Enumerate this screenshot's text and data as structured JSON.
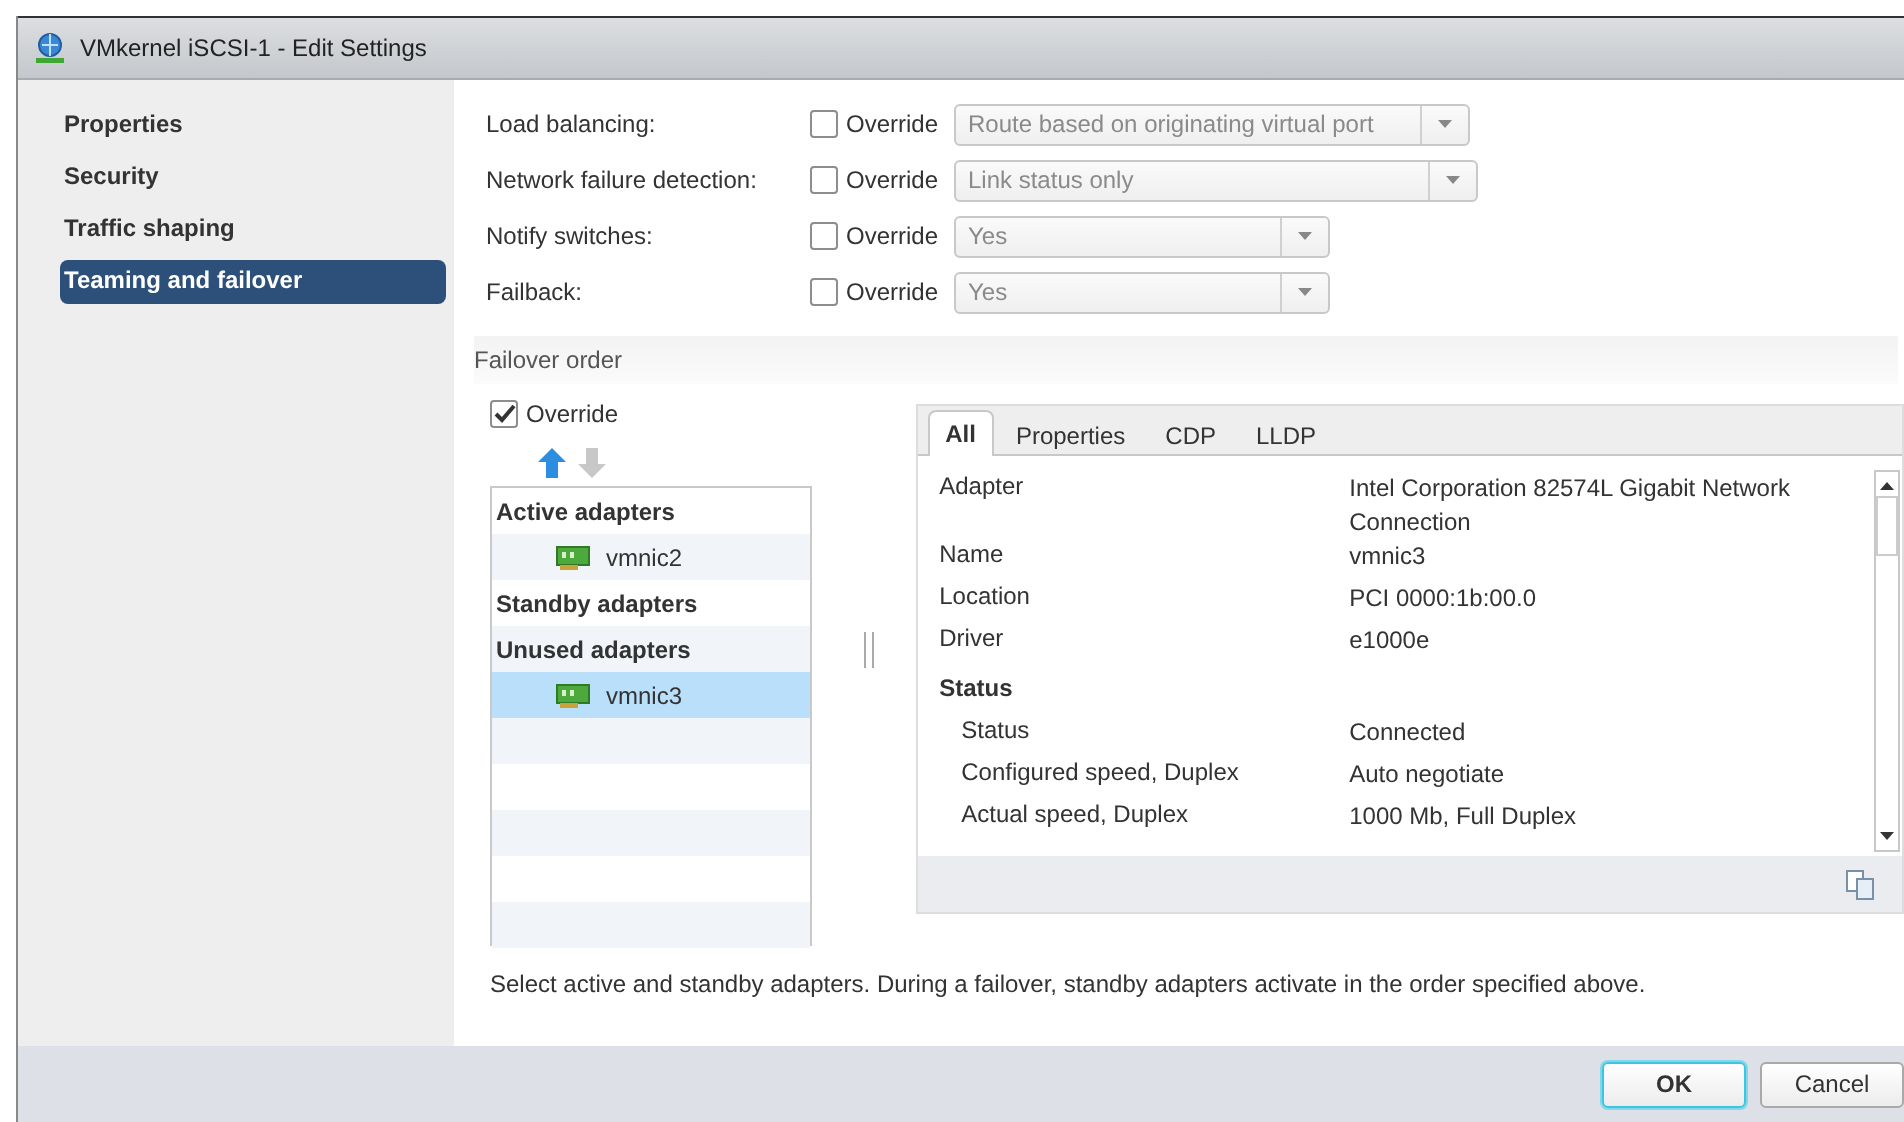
{
  "window": {
    "title": "VMkernel iSCSI-1 - Edit Settings"
  },
  "sidebar": {
    "items": [
      {
        "label": "Properties",
        "selected": false
      },
      {
        "label": "Security",
        "selected": false
      },
      {
        "label": "Traffic shaping",
        "selected": false
      },
      {
        "label": "Teaming and failover",
        "selected": true
      }
    ]
  },
  "settings": [
    {
      "label": "Load balancing:",
      "override_label": "Override",
      "checked": false,
      "value": "Route based on originating virtual port"
    },
    {
      "label": "Network failure detection:",
      "override_label": "Override",
      "checked": false,
      "value": "Link status only"
    },
    {
      "label": "Notify switches:",
      "override_label": "Override",
      "checked": false,
      "value": "Yes"
    },
    {
      "label": "Failback:",
      "override_label": "Override",
      "checked": false,
      "value": "Yes"
    }
  ],
  "failover": {
    "title": "Failover order",
    "override_label": "Override",
    "checked": true,
    "move_up_disabled": false,
    "move_down_disabled": true,
    "adapters": [
      {
        "kind": "header",
        "label": "Active adapters"
      },
      {
        "kind": "adapter",
        "label": "vmnic2",
        "selected": false
      },
      {
        "kind": "header",
        "label": "Standby adapters"
      },
      {
        "kind": "header",
        "label": "Unused adapters"
      },
      {
        "kind": "adapter",
        "label": "vmnic3",
        "selected": true
      }
    ],
    "tabs": [
      {
        "label": "All",
        "selected": true
      },
      {
        "label": "Properties",
        "selected": false
      },
      {
        "label": "CDP",
        "selected": false
      },
      {
        "label": "LLDP",
        "selected": false
      }
    ],
    "details": [
      {
        "kind": "field",
        "name": "Adapter",
        "value": "Intel Corporation 82574L Gigabit Network Connection"
      },
      {
        "kind": "field",
        "name": "Name",
        "value": "vmnic3"
      },
      {
        "kind": "field",
        "name": "Location",
        "value": "PCI 0000:1b:00.0"
      },
      {
        "kind": "field",
        "name": "Driver",
        "value": "e1000e"
      },
      {
        "kind": "section",
        "name": "Status"
      },
      {
        "kind": "subfield",
        "name": "Status",
        "value": "Connected"
      },
      {
        "kind": "subfield",
        "name": "Configured speed, Duplex",
        "value": "Auto negotiate"
      },
      {
        "kind": "subfield",
        "name": "Actual speed, Duplex",
        "value": "1000 Mb, Full Duplex"
      }
    ],
    "hint": "Select active and standby adapters. During a failover, standby adapters activate in the order specified above."
  },
  "buttons": [
    {
      "label": "OK",
      "kind": "primary"
    },
    {
      "label": "Cancel",
      "kind": "secondary"
    }
  ]
}
